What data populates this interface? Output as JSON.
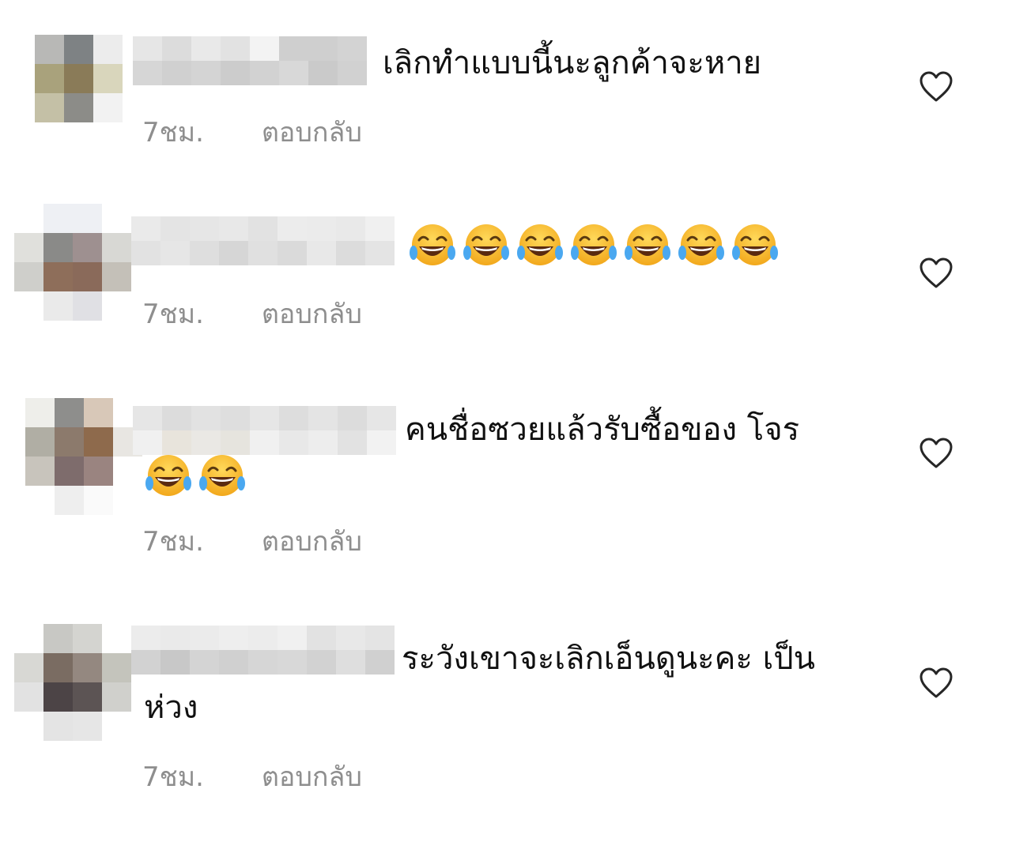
{
  "comments": [
    {
      "text": "เลิกทำแบบนี้นะลูกค้าจะหาย",
      "text_cont": "",
      "emoji_count": 0,
      "time": "7ชม.",
      "reply_label": "ตอบกลับ"
    },
    {
      "text": "",
      "text_cont": "",
      "emoji_count": 7,
      "emoji_name": "face-with-tears-of-joy-icon",
      "time": "7ชม.",
      "reply_label": "ตอบกลับ"
    },
    {
      "text": "คนชื่อซวยแล้วรับซื้อของ โจร",
      "text_cont": "",
      "emoji_count": 2,
      "emoji_name": "face-with-tears-of-joy-icon",
      "time": "7ชม.",
      "reply_label": "ตอบกลับ"
    },
    {
      "text": "ระวังเขาจะเลิกเอ็นดูนะคะ เป็น",
      "text_cont": "ห่วง",
      "emoji_count": 0,
      "time": "7ชม.",
      "reply_label": "ตอบกลับ"
    }
  ],
  "icons": {
    "like": "heart-outline-icon",
    "emoji": "face-with-tears-of-joy-icon"
  },
  "colors": {
    "meta_text": "#8e8e8e",
    "comment_text": "#111111",
    "heart_stroke": "#262626"
  }
}
